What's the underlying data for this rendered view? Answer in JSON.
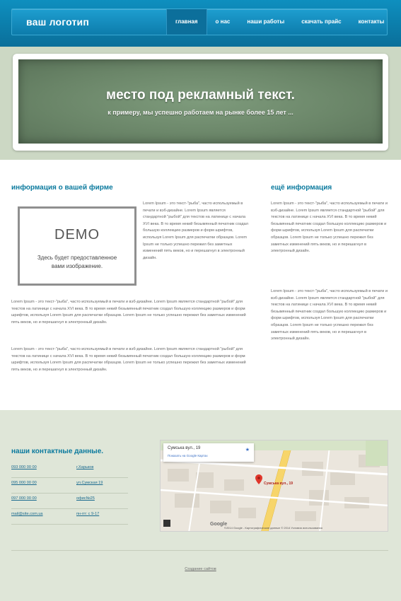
{
  "header": {
    "logo": "ваш логотип",
    "nav": [
      {
        "label": "главная",
        "active": true
      },
      {
        "label": "о нас",
        "active": false
      },
      {
        "label": "наши работы",
        "active": false
      },
      {
        "label": "скачать прайс",
        "active": false
      },
      {
        "label": "контакты",
        "active": false
      }
    ]
  },
  "banner": {
    "title": "место под рекламный текст.",
    "subtitle": "к примеру, мы успешно работаем на рынке более 15 лет ..."
  },
  "about": {
    "title": "информация о вашей фирме",
    "demo_logo": "DEMO",
    "demo_text_line1": "Здесь будет предоставленное",
    "demo_text_line2": "вами изображение.",
    "side_paragraph": "Lorem Ipsum - это текст-\"рыба\", часто используемый в печати и вэб-дизайне. Lorem Ipsum является стандартной \"рыбой\" для текстов на латинице с начала XVI века. В то время некий безымянный печатник создал большую коллекцию размеров и форм шрифтов, используя Lorem Ipsum для распечатки образцов. Lorem Ipsum не только успешно пережил без заметных изменений пять веков, но и перешагнул в электронный дизайн.",
    "paragraph_1": "Lorem Ipsum - это текст-\"рыба\", часто используемый в печати и вэб-дизайне. Lorem Ipsum является стандартной \"рыбой\" для текстов на латинице с начала XVI века. В то время некий безымянный печатник создал большую коллекцию размеров и форм шрифтов, используя Lorem Ipsum для распечатки образцов. Lorem Ipsum не только успешно пережил без заметных изменений пять веков, но и перешагнул в электронный дизайн.",
    "paragraph_2": "Lorem Ipsum - это текст-\"рыба\", часто используемый в печати и вэб-дизайне. Lorem Ipsum является стандартной \"рыбой\" для текстов на латинице с начала XVI века. В то время некий безымянный печатник создал большую коллекцию размеров и форм шрифтов, используя Lorem Ipsum для распечатки образцов. Lorem Ipsum не только успешно пережил без заметных изменений пять веков, но и перешагнул в электронный дизайн."
  },
  "more": {
    "title": "ещё информация",
    "paragraph_1": "Lorem Ipsum - это текст-\"рыба\", часто используемый в печати и вэб-дизайне. Lorem Ipsum является стандартной \"рыбой\" для текстов на латинице с начала XVI века. В то время некий безымянный печатник создал большую коллекцию размеров и форм шрифтов, используя Lorem Ipsum для распечатки образцов. Lorem Ipsum не только успешно пережил без заметных изменений пять веков, но и перешагнул в электронный дизайн.",
    "paragraph_2": "Lorem Ipsum - это текст-\"рыба\", часто используемый в печати и вэб-дизайне. Lorem Ipsum является стандартной \"рыбой\" для текстов на латинице с начала XVI века. В то время некий безымянный печатник создал большую коллекцию размеров и форм шрифтов, используя Lorem Ipsum для распечатки образцов. Lorem Ipsum не только успешно пережил без заметных изменений пять веков, но и перешагнул в электронный дизайн."
  },
  "contacts": {
    "title": "наши контактные данные.",
    "rows": [
      {
        "left": "093 000 00 00",
        "right": "г.Харьков"
      },
      {
        "left": "095 000 00 00",
        "right": "ул.Сумская 19"
      },
      {
        "left": "097 000 00 00",
        "right": "офис№25"
      },
      {
        "left": "mail@site.com.ua",
        "right": "пн-пт: с 9-17"
      }
    ]
  },
  "map": {
    "card_title": "Сумська вул., 19",
    "card_link": "Показать на Google Картах",
    "pin_label": "Сумська вул., 19",
    "google": "Google",
    "attribution": "©2014 Google - Картографические данные © 2014 Условия использования"
  },
  "footer": {
    "copyright": "Создание сайтов"
  },
  "colors": {
    "accent": "#0b7a9e",
    "header": "#0e8fbf",
    "band": "#ccd8c4",
    "footer": "#dfe6d8"
  }
}
